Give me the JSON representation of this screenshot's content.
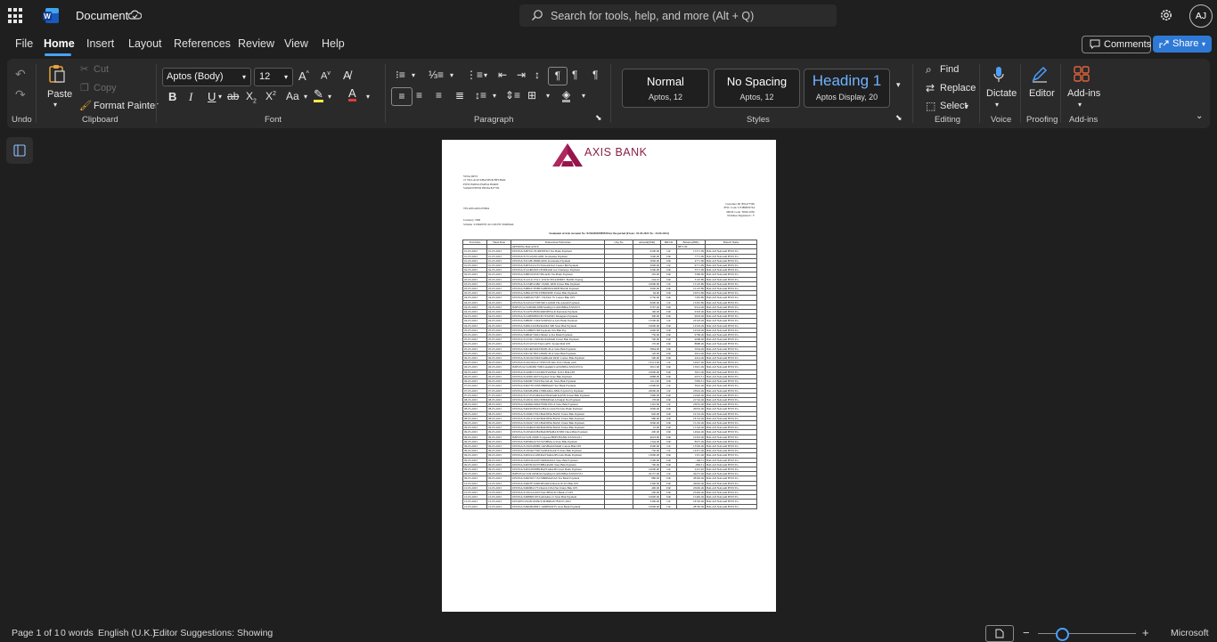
{
  "titlebar": {
    "doc_title": "Document",
    "search_placeholder": "Search for tools, help, and more (Alt + Q)",
    "avatar_initials": "AJ"
  },
  "menu": {
    "tabs": [
      "File",
      "Home",
      "Insert",
      "Layout",
      "References",
      "Review",
      "View",
      "Help"
    ],
    "comments": "Comments",
    "share": "Share"
  },
  "ribbon": {
    "undo_group": "Undo",
    "paste": "Paste",
    "cut": "Cut",
    "copy": "Copy",
    "format_painter": "Format Painter",
    "clipboard_group": "Clipboard",
    "font_name": "Aptos (Body)",
    "font_size": "12",
    "font_group": "Font",
    "paragraph_group": "Paragraph",
    "styles": [
      {
        "name": "Normal",
        "sub": "Aptos, 12"
      },
      {
        "name": "No Spacing",
        "sub": "Aptos, 12"
      },
      {
        "name": "Heading 1",
        "sub": "Aptos Display, 20"
      }
    ],
    "styles_group": "Styles",
    "find": "Find",
    "replace": "Replace",
    "select": "Select",
    "editing_group": "Editing",
    "dictate": "Dictate",
    "voice_group": "Voice",
    "editor": "Editor",
    "proofing_group": "Proofing",
    "addins": "Add-ins",
    "addins_group": "Add-ins"
  },
  "statement": {
    "bank_name": "AXIS BANK",
    "customer_block": [
      "VINA DEVI",
      "21 VILLAGE KHANPUR BELHAR",
      "POST-PARSA PARSA 694460",
      "SAMASTIPUR INDIA 847706"
    ],
    "state_line": "TELANGANA INDIA",
    "right_block": [
      "Customer ID :891477590",
      "IFSC Code :UTIB0003744",
      "MICR Code :500211050",
      "Nominee Registered : Y"
    ],
    "currency": "Currency :INR",
    "scheme": "Scheme :CURRENT ACCOUNT NORMAL",
    "title": "Statement of Axis Account No :923020003989558 for the period (From : 01.05.2023 To : 23.05.2023)",
    "columns": [
      "Tran Date",
      "Value Date",
      "Transaction Particulars",
      "Chq No",
      "Amount(INR)",
      "DR/CR",
      "Balance(INR)",
      "Branch Name"
    ],
    "opening": {
      "particulars": "OPENING BALANCE",
      "balance": "8871.99"
    },
    "branch": "BALAJI NAGAR HYD TG",
    "rows": [
      [
        "01-05-2023",
        "01-05-2023",
        "UPI/P2A/3487161/SURESH/ICI Yes Bank Payment",
        "6500.00",
        "CR",
        "15371.99"
      ],
      [
        "01-05-2023",
        "01-05-2023",
        "UPI/P2A/3155/22220/ANIL Karnataka Payment",
        "7600.00",
        "DR",
        "7771.99"
      ],
      [
        "01-05-2023",
        "01-05-2023",
        "UPI/P2A/3321281/8968/ANIL Karnataka Payment",
        "3000.00",
        "DR",
        "4771.99"
      ],
      [
        "01-05-2023",
        "01-05-2023",
        "UPI/P2A/3487164/1155/SAGAR Kal Canara Bk Payment",
        "2000.00",
        "CR",
        "6771.99"
      ],
      [
        "02-05-2023",
        "02-05-2023",
        "UPI/P2A/3122460/6651/PODDAR GA Chaitanya Payment",
        "3200.00",
        "DR",
        "3571.99"
      ],
      [
        "02-05-2023",
        "02-05-2023",
        "UPI/P2A/3488310/6567/PhonePe Yes Bank Payment",
        "202.00",
        "DR",
        "3369.99"
      ],
      [
        "03-05-2023",
        "03-05-2023",
        "UPI/P2A/3122141/5521/ WWW.TEJASHDFC BANK Paying",
        "244.10",
        "DR",
        "3125.89"
      ],
      [
        "03-05-2023",
        "03-05-2023",
        "UPI/P2A/3123485/2486/ VANIL RED Union Bnk Payment",
        "10000.00",
        "CR",
        "13125.89"
      ],
      [
        "03-05-2023",
        "03-05-2023",
        "UPI/P2A/3488167/8588/SAHEBZADEH BOOK Payment",
        "3000.00",
        "DR",
        "10125.89"
      ],
      [
        "03-05-2023",
        "03-05-2023",
        "UPI/P2A/3489129/7813/PHONEPE Union Bnk Payment",
        "94.00",
        "DR",
        "10031.89"
      ],
      [
        "04-05-2023",
        "04-05-2023",
        "UPI/P2A/3498166/7587/ VIJAYA/ W Canara Bnk UPI",
        "2750.00",
        "DR",
        "7281.89"
      ],
      [
        "04-05-2023",
        "04-05-2023",
        "UPI/P2A/3124314/7238/SRI LAXMI The Adarsh Payment",
        "6000.00",
        "CR",
        "13281.89"
      ],
      [
        "04-05-2023",
        "04-05-2023",
        "IMPS/P2A/312600612809/Sandhya/CANONBA/XXXX53",
        "3767.40",
        "DR",
        "9514.49"
      ],
      [
        "04-05-2023",
        "04-05-2023",
        "UPI/P2A/3124793/8956/KRISHNA R Karnatak Payment",
        "196.00",
        "DR",
        "9318.49"
      ],
      [
        "04-05-2023",
        "04-05-2023",
        "UPI/P2A/3124858/8816/D TEJAVID Telangana Payment",
        "300.00",
        "DR",
        "9018.49"
      ],
      [
        "04-05-2023",
        "04-05-2023",
        "UPI/P2A/3488297/1464/SUKHALA Axis Bank Payment",
        "13500.00",
        "CR",
        "22518.49"
      ],
      [
        "04-05-2023",
        "04-05-2023",
        "UPI/P2A/3499124/4584/RAMA SBI State Bnk Payment",
        "10000.00",
        "DR",
        "12518.49"
      ],
      [
        "05-05-2023",
        "05-05-2023",
        "UPI/P2A/3124898/5748/Jayanada Yes Bnk Pay",
        "2000.00",
        "DR",
        "10518.49"
      ],
      [
        "05-05-2023",
        "05-05-2023",
        "UPI/P2A/3488427/4961/Shanti A Yes Bank Payment",
        "750.00",
        "DR",
        "9768.49"
      ],
      [
        "05-05-2023",
        "05-05-2023",
        "UPI/P2A/3125501/1929/KURAMAR Union Bnk Payment",
        "700.00",
        "DR",
        "9068.49"
      ],
      [
        "05-05-2023",
        "05-05-2023",
        "UPI/P2A/3125/10510/VALLAPU/ Kotak Mah UPI",
        "170.00",
        "DR",
        "8898.49"
      ],
      [
        "05-05-2023",
        "05-05-2023",
        "UPI/P2A/3491466/6663/PATIL/ILA State Bnk Payment",
        "3864.00",
        "DR",
        "5034.49"
      ],
      [
        "05-05-2023",
        "05-05-2023",
        "UPI/P2A/3491347/8651/PATIL/ILA State Bnk Payment",
        "120.00",
        "DR",
        "4914.49"
      ],
      [
        "06-05-2023",
        "06-05-2023",
        "UPI/P2A/3126416/5964/SARKAR PASE Canara Bnk Payment",
        "500.00",
        "DR",
        "4414.49"
      ],
      [
        "06-05-2023",
        "06-05-2023",
        "UPI/P2A/3126218/4117/ENVON PAL ICICI Bank with",
        "12513.00",
        "CR",
        "16927.49"
      ],
      [
        "06-05-2023",
        "06-05-2023",
        "IMPS/P2A/312609917990/Lakshmi/CANONBA/XXXX5531",
        "3012.00",
        "DR",
        "13915.49"
      ],
      [
        "06-05-2023",
        "06-05-2023",
        "UPI/P2A/3126903/1516/RIOTVAHAL ICICI Bnk UPI",
        "10000.00",
        "DR",
        "3915.49"
      ],
      [
        "06-05-2023",
        "06-05-2023",
        "UPI/P2A/3126831/6075/Jayalal/ State Bnk Payment",
        "6888.00",
        "DR",
        "-2972.51"
      ],
      [
        "06-05-2023",
        "06-05-2023",
        "UPI/P2A/3492967/5919/NAJALAL State Bnk Payment",
        "4111.00",
        "DR",
        "-7083.51"
      ],
      [
        "07-05-2023",
        "07-05-2023",
        "UPI/P2A/3492730/1958/SHRIMAN Yes Bank Payment",
        "11000.00",
        "CR",
        "3916.49"
      ],
      [
        "07-05-2023",
        "07-05-2023",
        "UPI/P2A/3493284/8841/SHIJAMA-SBIL Paytm Pay Payment",
        "20000.00",
        "CR",
        "23916.49"
      ],
      [
        "07-05-2023",
        "07-05-2023",
        "UPI/P2A/3127474/5484/KANNADAR KANN Union Bnk Payment",
        "1996.00",
        "DR",
        "21920.49"
      ],
      [
        "08-05-2023",
        "08-05-2023",
        "UPI/P2A/3128211/6652/SHEKHAR A Punjab Nat Payment",
        "178.00",
        "DR",
        "21742.49"
      ],
      [
        "08-05-2023",
        "08-05-2023",
        "UPI/P2A/3494842/4994/YERLPULA State Bnk Payment",
        "1310.00",
        "CR",
        "23052.49"
      ],
      [
        "08-05-2023",
        "08-05-2023",
        "UPI/P2A/3494350/8419/CHALLAGUNI Axis Bank Payment",
        "3000.00",
        "DR",
        "20052.49"
      ],
      [
        "08-05-2023",
        "08-05-2023",
        "UPI/P2A/3129002/7061/BADSHA BASU Union Bnk Payment",
        "920.00",
        "DR",
        "19132.49"
      ],
      [
        "08-05-2023",
        "08-05-2023",
        "UPI/P2A/3129141/6140/BADSHA BASU Union Bnk Payment",
        "980.00",
        "DR",
        "18152.49"
      ],
      [
        "09-05-2023",
        "09-05-2023",
        "UPI/P2A/3129247/1951/BADSHA BASU Union Bnk Payment",
        "3000.00",
        "DR",
        "15152.49"
      ],
      [
        "09-05-2023",
        "09-05-2023",
        "UPI/P2A/3129466/6199/BADSHA BASU Union Bnk Payment",
        "10.00",
        "DR",
        "15142.49"
      ],
      [
        "09-05-2023",
        "09-05-2023",
        "UPI/P2A/3129549/4384/BADSHAHAN/SBI Union Bnk Payment",
        "200.00",
        "DR",
        "14942.49"
      ],
      [
        "09-05-2023",
        "09-05-2023",
        "IMPS/P2A/312911828131/ajeeeu/HDFCBANK/XXXX2221",
        "4623.00",
        "DR",
        "10319.49"
      ],
      [
        "09-05-2023",
        "09-05-2023",
        "UPI/P2A/3495606/4752/SUSHMA A State Bnk Payment",
        "1344.00",
        "DR",
        "8975.49"
      ],
      [
        "09-05-2023",
        "09-05-2023",
        "UPI/P2A/3129224/9989/ AKSHAKUMAR Canara Bnk UPI",
        "4590.00",
        "CR",
        "13565.49"
      ],
      [
        "09-05-2023",
        "09-05-2023",
        "UPI/P2A/3129546/7590/SANDOGAR N State Bnk Payment",
        "750.00",
        "CR",
        "14315.49"
      ],
      [
        "09-05-2023",
        "09-05-2023",
        "UPI/P2A/3495164/1438/DATTARAJPO Axis Bank Payment",
        "13000.00",
        "DR",
        "1315.49"
      ],
      [
        "09-05-2023",
        "09-05-2023",
        "UPI/P2A/3495196/4470/SRIMANAS State Bnk Payment",
        "1500.00",
        "DR",
        "-184.51"
      ],
      [
        "09-05-2023",
        "09-05-2023",
        "UPI/P2A/3495593/6270/BHARANI State Bnk Payment",
        "700.00",
        "DR",
        "-884.51"
      ],
      [
        "09-05-2023",
        "09-05-2023",
        "UPI/P2A/3495168/9889/BATTARAJPO Axis Bank Payment",
        "10000.00",
        "CR",
        "9115.49"
      ],
      [
        "09-05-2023",
        "09-05-2023",
        "IMPS/P2A/312910258261/Sandhya/CANONBA/XXXX5531",
        "20157.00",
        "CR",
        "29272.49"
      ],
      [
        "09-05-2023",
        "09-05-2023",
        "UPI/P2A/3496330/7152/SHRIMANAS Yes Bank Payment",
        "880.00",
        "DR",
        "28392.49"
      ],
      [
        "10-05-2023",
        "10-05-2023",
        "UPI/P2A/3496787/4499/DIVARASKA-K/ICICI Bnk UPI",
        "2300.00",
        "DR",
        "26092.49"
      ],
      [
        "10-05-2023",
        "10-05-2023",
        "UPI/P2A/3496984/1731/KALLIVAI Nai Union Bnk UPI",
        "400.00",
        "DR",
        "25692.49"
      ],
      [
        "10-05-2023",
        "10-05-2023",
        "UPI/P2A/3130214/1025/SAC/BNA/ICI Bank of UPI",
        "200.00",
        "DR",
        "25492.49"
      ],
      [
        "10-05-2023",
        "10-05-2023",
        "UPI/P2A/3498998/1874/ADARA 21 State Bnk Payment",
        "10000.00",
        "DR",
        "15492.49"
      ],
      [
        "10-05-2023",
        "10-05-2023",
        "UPI/OPW/01G8C0ZPR/3/493B9645/7839 05 2023",
        "3300.00",
        "CR",
        "18792.49"
      ],
      [
        "10-05-2023",
        "10-05-2023",
        "UPI/P2A/3496286/8891/ ARDHANTV Axis Bank Payment",
        "10000.00",
        "CR",
        "28792.49"
      ]
    ]
  },
  "statusbar": {
    "page": "Page 1 of 1",
    "words": "0 words",
    "language": "English (U.K.)",
    "suggestions": "Editor Suggestions: Showing",
    "minus": "−",
    "plus": "+",
    "brand": "Microsoft",
    "zoom_fraction": 0.25
  },
  "colors": {
    "accent": "#2f79d6",
    "bank": "#8a1f47"
  }
}
